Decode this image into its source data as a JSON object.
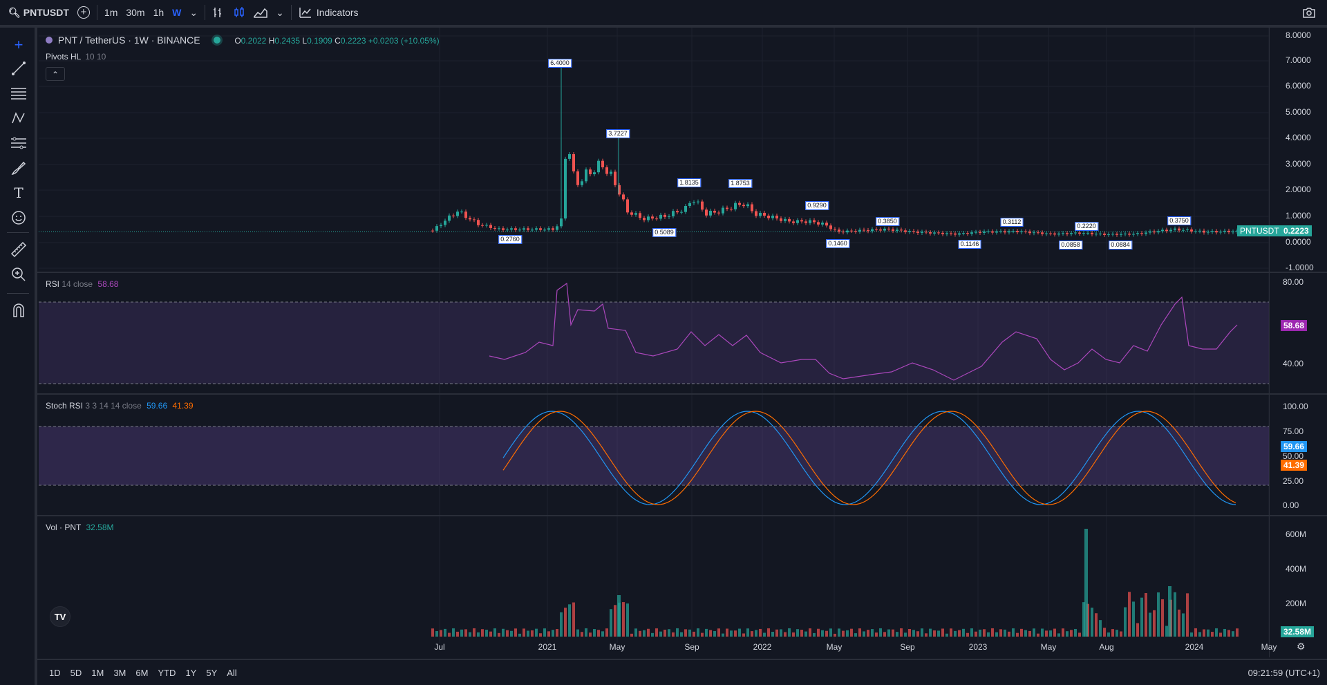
{
  "toolbar": {
    "symbol": "PNTUSDT",
    "timeframes": [
      "1m",
      "30m",
      "1h",
      "W"
    ],
    "indicators_label": "Indicators"
  },
  "chart": {
    "title": "PNT / TetherUS · 1W · BINANCE",
    "ohlc": {
      "o_label": "O",
      "o": "0.2022",
      "h_label": "H",
      "h": "0.2435",
      "l_label": "L",
      "l": "0.1909",
      "c_label": "C",
      "c": "0.2223",
      "change": "+0.0203 (+10.05%)"
    },
    "indicator_label": "Pivots HL",
    "indicator_params": "10 10",
    "price_badge_symbol": "PNTUSDT",
    "price_badge_value": "0.2223",
    "price_axis": [
      "8.0000",
      "7.0000",
      "6.0000",
      "5.0000",
      "4.0000",
      "3.0000",
      "2.0000",
      "1.0000",
      "0.0000",
      "-1.0000"
    ],
    "pivots_high": [
      "6.4000",
      "3.7227",
      "1.8135",
      "1.8753",
      "0.9290",
      "0.3850",
      "0.3112",
      "0.2220",
      "0.3750"
    ],
    "pivots_low": [
      "0.2760",
      "0.5089",
      "0.1460",
      "0.1146",
      "0.0858",
      "0.0884"
    ]
  },
  "rsi": {
    "label": "RSI",
    "params": "14 close",
    "value": "58.68",
    "axis": [
      "80.00",
      "40.00"
    ]
  },
  "stoch": {
    "label": "Stoch RSI",
    "params": "3 3 14 14 close",
    "k": "59.66",
    "d": "41.39",
    "axis": [
      "100.00",
      "75.00",
      "50.00",
      "25.00",
      "0.00"
    ]
  },
  "volume": {
    "label": "Vol · PNT",
    "value": "32.58M",
    "axis": [
      "600M",
      "400M",
      "200M"
    ]
  },
  "time_axis": [
    "Jul",
    "2021",
    "May",
    "Sep",
    "2022",
    "May",
    "Sep",
    "2023",
    "May",
    "Aug",
    "2024",
    "May"
  ],
  "ranges": [
    "1D",
    "5D",
    "1M",
    "3M",
    "6M",
    "YTD",
    "1Y",
    "5Y",
    "All"
  ],
  "clock": "09:21:59 (UTC+1)",
  "colors": {
    "up": "#26a69a",
    "down": "#ef5350",
    "rsi": "#ab47bc",
    "stoch_k": "#2196f3",
    "stoch_d": "#ff6d00",
    "accent": "#2962ff"
  }
}
